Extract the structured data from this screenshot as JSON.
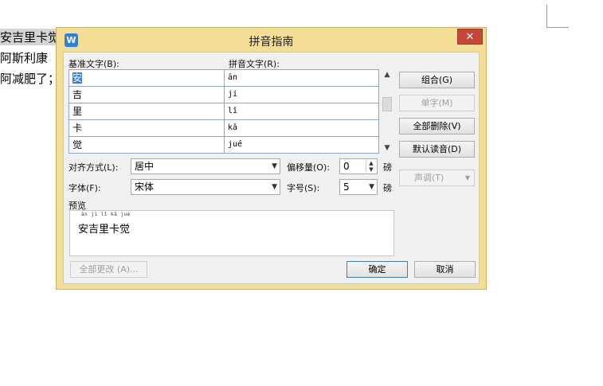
{
  "document": {
    "lines": [
      "安吉里卡觉",
      "阿斯利康",
      "阿减肥了；"
    ]
  },
  "dialog": {
    "app_icon": "W",
    "title": "拼音指南",
    "close_label": "✕",
    "base_text_label": "基准文字(B):",
    "pinyin_text_label": "拼音文字(R):",
    "rows": [
      {
        "base": "安",
        "pinyin": "ān"
      },
      {
        "base": "吉",
        "pinyin": "jí"
      },
      {
        "base": "里",
        "pinyin": "lǐ"
      },
      {
        "base": "卡",
        "pinyin": "kǎ"
      },
      {
        "base": "觉",
        "pinyin": "jué"
      }
    ],
    "buttons": {
      "combine": "组合(G)",
      "single": "单字(M)",
      "clear_all": "全部删除(V)",
      "default_reading": "默认读音(D)",
      "tone": "声调(T)",
      "apply_all": "全部更改 (A)...",
      "ok": "确定",
      "cancel": "取消"
    },
    "align_label": "对齐方式(L):",
    "align_value": "居中",
    "offset_label": "偏移量(O):",
    "offset_value": "0",
    "offset_unit": "磅",
    "font_label": "字体(F):",
    "font_value": "宋体",
    "size_label": "字号(S):",
    "size_value": "5",
    "size_unit": "磅",
    "preview_label": "预览",
    "preview_pinyin": "ān  jí  lǐ  kǎ  jué",
    "preview_text": "安吉里卡觉"
  },
  "colors": {
    "dialog_frame": "#f4dd94",
    "close_button": "#c7463a",
    "selection": "#3b7dd8"
  }
}
